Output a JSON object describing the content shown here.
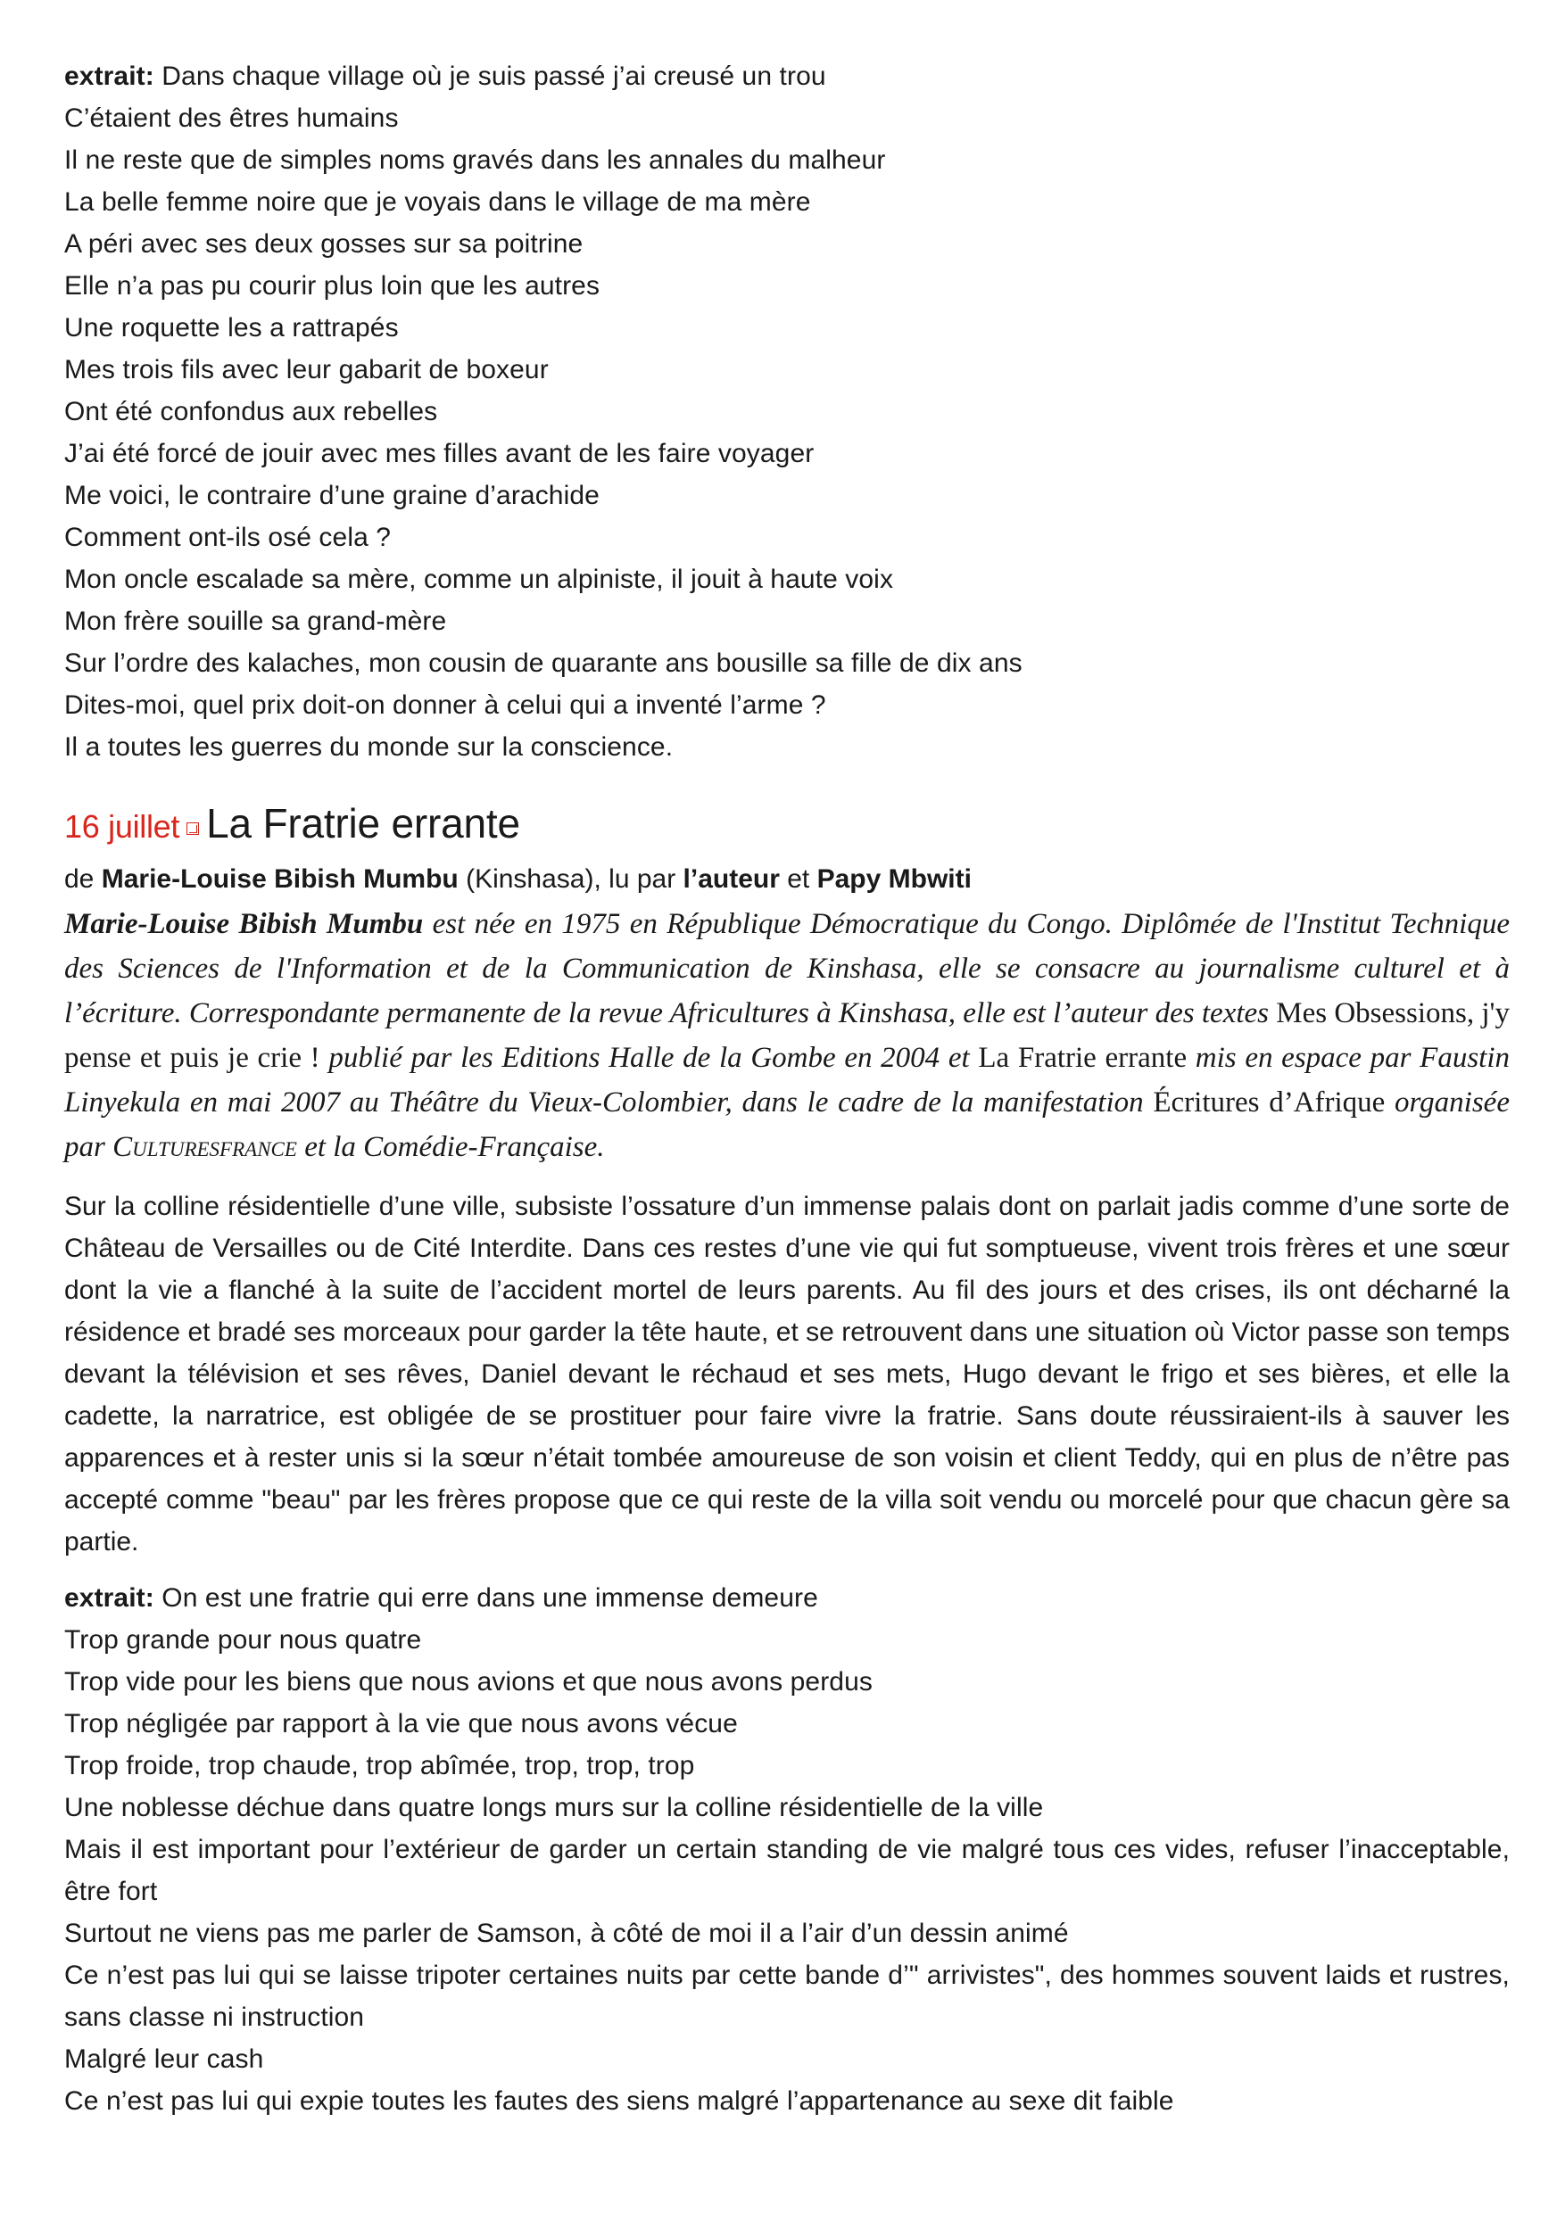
{
  "extract1": {
    "label": "extrait",
    "sep": ":",
    "lines": [
      " Dans chaque village où je suis passé j’ai creusé un trou",
      "C’étaient des êtres humains",
      "Il ne reste que de simples noms gravés dans les annales du malheur",
      "La belle femme noire que je voyais dans le village de ma mère",
      "A péri avec ses deux gosses sur sa poitrine",
      "Elle n’a pas pu courir plus loin que les autres",
      "Une roquette les a rattrapés",
      "Mes trois fils avec leur gabarit de boxeur",
      "Ont été confondus aux rebelles",
      "J’ai été forcé de jouir avec mes filles avant de les faire voyager",
      "Me voici, le contraire d’une graine d’arachide",
      "Comment ont-ils osé cela ?",
      "Mon oncle escalade sa mère, comme un alpiniste, il jouit à haute voix",
      "Mon frère souille sa grand-mère",
      "Sur l’ordre des kalaches, mon cousin de quarante ans bousille sa fille de dix ans",
      "Dites-moi, quel prix doit-on donner à celui qui a inventé l’arme ?",
      "Il a toutes les guerres du monde sur la conscience."
    ]
  },
  "event": {
    "date": "16 juillet",
    "title": "La Fratrie errante",
    "byline": {
      "prefix": "de ",
      "author": "Marie-Louise Bibish Mumbu",
      "place": " (Kinshasa), lu par ",
      "reader1": "l’auteur",
      "and": " et ",
      "reader2": "Papy Mbwiti"
    },
    "bio": {
      "name": "Marie-Louise Bibish Mumbu",
      "t1": " est née en 1975 en République Démocratique du Congo. Diplômée de l'Institut Technique des Sciences de l'Information et de la Communication de Kinshasa, elle se consacre au journalisme culturel et à l’écriture. Correspondante permanente de la revue Africultures à Kinshasa, elle est l’auteur des textes ",
      "work1": "Mes Obsessions, j'y pense et puis je crie !",
      "t2": " publié par les Editions Halle de la Gombe en 2004 et ",
      "work2": "La Fratrie errante",
      "t3": " mis en espace par Faustin Linyekula en mai 2007 au Théâtre du Vieux-Colombier, dans le cadre de la manifestation ",
      "work3": "Écritures d’Afrique",
      "t4": " organisée par ",
      "org": "Culturesfrance",
      "t5": " et la Comédie-Française."
    },
    "summary": "Sur la colline résidentielle d’une ville, subsiste l’ossature d’un immense palais dont on parlait jadis comme d’une sorte de Château de Versailles ou de Cité Interdite. Dans ces restes d’une vie qui fut somptueuse, vivent trois frères et une sœur dont la vie a flanché à la suite de l’accident mortel de leurs parents. Au fil des jours et des crises, ils ont décharné la résidence et bradé ses morceaux pour garder la tête haute, et se retrouvent dans une situation où Victor passe son temps devant la télévision et ses rêves, Daniel devant le réchaud et ses mets, Hugo devant le frigo et ses bières, et elle la cadette, la nar­ratrice, est obligée de se prostituer pour faire vivre la fratrie. Sans doute réussiraient-ils à sauver les apparences et à rester unis si la sœur n’était tombée amoureuse de son voisin et client Teddy, qui en plus de n’être pas accepté comme \"beau\" par les frères propose que ce qui reste de la villa soit vendu ou morcelé pour que chacun gère sa partie."
  },
  "extract2": {
    "label": "extrait",
    "sep": ":",
    "lines": [
      " On est une fratrie qui erre dans une immense demeure",
      "Trop grande pour nous quatre",
      "Trop vide pour les biens que nous avions et que nous avons perdus",
      "Trop négligée par rapport à la vie que nous avons vécue",
      "Trop froide, trop chaude, trop abîmée, trop, trop, trop",
      "Une noblesse déchue dans quatre longs murs sur la colline résidentielle de la ville",
      "Mais il est important pour l’extérieur de garder un certain standing de vie malgré tous ces vides, refu­ser l’inacceptable, être fort",
      "Surtout ne viens pas me parler de Samson, à côté de moi il a l’air d’un dessin animé",
      "Ce n’est pas lui qui se laisse tripoter certaines nuits par cette bande d’\" arrivistes\", des hommes souvent laids et rustres, sans classe ni instruction",
      "Malgré leur cash",
      "Ce n’est pas lui qui expie toutes les fautes des siens malgré l’appartenance au sexe dit faible"
    ]
  }
}
